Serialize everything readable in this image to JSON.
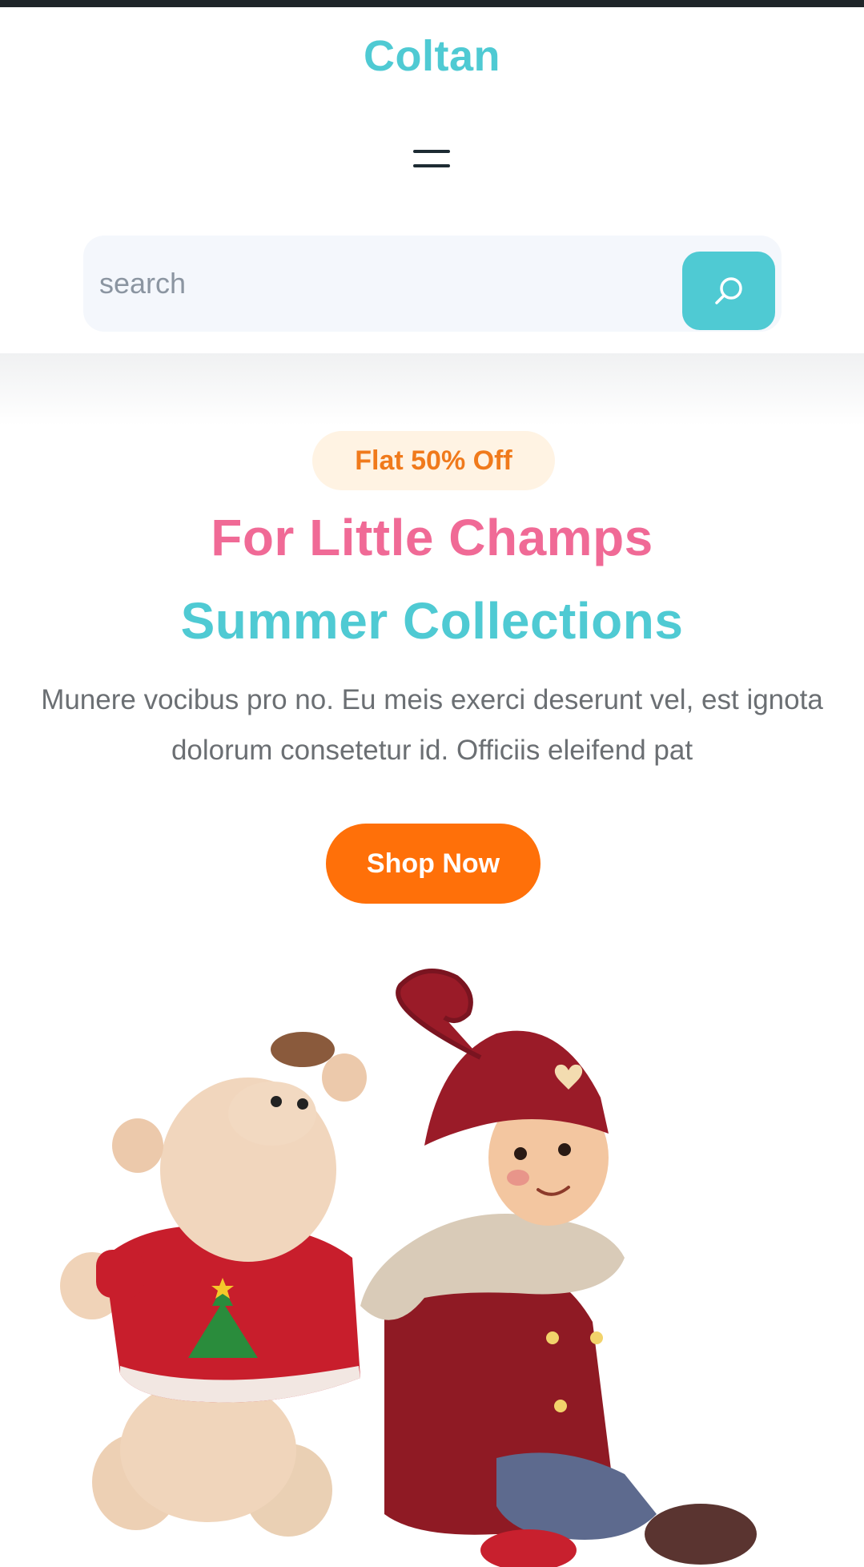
{
  "brand": {
    "name": "Coltan",
    "color": "#4fcad3"
  },
  "header": {
    "menu_icon": "hamburger-menu-icon"
  },
  "search": {
    "placeholder": "search",
    "value": "",
    "button_icon": "search-icon",
    "button_color": "#4fcad3"
  },
  "hero": {
    "badge": "Flat 50% Off",
    "headline_line1": "For Little Champs",
    "headline_line2": "Summer Collections",
    "description": "Munere vocibus pro no. Eu meis exerci deserunt vel, est ignota dolorum consetetur id. Officiis eleifend pat",
    "cta_label": "Shop Now",
    "image_alt": "Plush hippo toy in red sweater and figurine child in red hat and scarf",
    "colors": {
      "badge_text": "#f07a1c",
      "headline1": "#f06a96",
      "headline2": "#4fcad3",
      "cta": "#ff7009"
    }
  }
}
